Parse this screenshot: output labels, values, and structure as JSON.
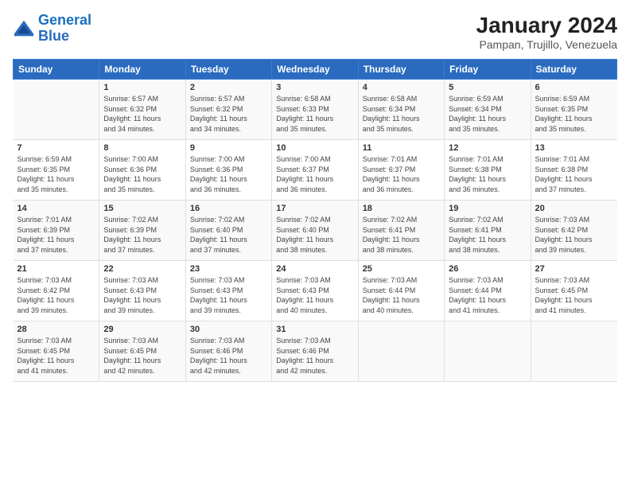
{
  "logo": {
    "line1": "General",
    "line2": "Blue"
  },
  "title": "January 2024",
  "location": "Pampan, Trujillo, Venezuela",
  "days_of_week": [
    "Sunday",
    "Monday",
    "Tuesday",
    "Wednesday",
    "Thursday",
    "Friday",
    "Saturday"
  ],
  "weeks": [
    [
      {
        "day": "",
        "info": ""
      },
      {
        "day": "1",
        "info": "Sunrise: 6:57 AM\nSunset: 6:32 PM\nDaylight: 11 hours\nand 34 minutes."
      },
      {
        "day": "2",
        "info": "Sunrise: 6:57 AM\nSunset: 6:32 PM\nDaylight: 11 hours\nand 34 minutes."
      },
      {
        "day": "3",
        "info": "Sunrise: 6:58 AM\nSunset: 6:33 PM\nDaylight: 11 hours\nand 35 minutes."
      },
      {
        "day": "4",
        "info": "Sunrise: 6:58 AM\nSunset: 6:34 PM\nDaylight: 11 hours\nand 35 minutes."
      },
      {
        "day": "5",
        "info": "Sunrise: 6:59 AM\nSunset: 6:34 PM\nDaylight: 11 hours\nand 35 minutes."
      },
      {
        "day": "6",
        "info": "Sunrise: 6:59 AM\nSunset: 6:35 PM\nDaylight: 11 hours\nand 35 minutes."
      }
    ],
    [
      {
        "day": "7",
        "info": "Sunrise: 6:59 AM\nSunset: 6:35 PM\nDaylight: 11 hours\nand 35 minutes."
      },
      {
        "day": "8",
        "info": "Sunrise: 7:00 AM\nSunset: 6:36 PM\nDaylight: 11 hours\nand 35 minutes."
      },
      {
        "day": "9",
        "info": "Sunrise: 7:00 AM\nSunset: 6:36 PM\nDaylight: 11 hours\nand 36 minutes."
      },
      {
        "day": "10",
        "info": "Sunrise: 7:00 AM\nSunset: 6:37 PM\nDaylight: 11 hours\nand 36 minutes."
      },
      {
        "day": "11",
        "info": "Sunrise: 7:01 AM\nSunset: 6:37 PM\nDaylight: 11 hours\nand 36 minutes."
      },
      {
        "day": "12",
        "info": "Sunrise: 7:01 AM\nSunset: 6:38 PM\nDaylight: 11 hours\nand 36 minutes."
      },
      {
        "day": "13",
        "info": "Sunrise: 7:01 AM\nSunset: 6:38 PM\nDaylight: 11 hours\nand 37 minutes."
      }
    ],
    [
      {
        "day": "14",
        "info": "Sunrise: 7:01 AM\nSunset: 6:39 PM\nDaylight: 11 hours\nand 37 minutes."
      },
      {
        "day": "15",
        "info": "Sunrise: 7:02 AM\nSunset: 6:39 PM\nDaylight: 11 hours\nand 37 minutes."
      },
      {
        "day": "16",
        "info": "Sunrise: 7:02 AM\nSunset: 6:40 PM\nDaylight: 11 hours\nand 37 minutes."
      },
      {
        "day": "17",
        "info": "Sunrise: 7:02 AM\nSunset: 6:40 PM\nDaylight: 11 hours\nand 38 minutes."
      },
      {
        "day": "18",
        "info": "Sunrise: 7:02 AM\nSunset: 6:41 PM\nDaylight: 11 hours\nand 38 minutes."
      },
      {
        "day": "19",
        "info": "Sunrise: 7:02 AM\nSunset: 6:41 PM\nDaylight: 11 hours\nand 38 minutes."
      },
      {
        "day": "20",
        "info": "Sunrise: 7:03 AM\nSunset: 6:42 PM\nDaylight: 11 hours\nand 39 minutes."
      }
    ],
    [
      {
        "day": "21",
        "info": "Sunrise: 7:03 AM\nSunset: 6:42 PM\nDaylight: 11 hours\nand 39 minutes."
      },
      {
        "day": "22",
        "info": "Sunrise: 7:03 AM\nSunset: 6:43 PM\nDaylight: 11 hours\nand 39 minutes."
      },
      {
        "day": "23",
        "info": "Sunrise: 7:03 AM\nSunset: 6:43 PM\nDaylight: 11 hours\nand 39 minutes."
      },
      {
        "day": "24",
        "info": "Sunrise: 7:03 AM\nSunset: 6:43 PM\nDaylight: 11 hours\nand 40 minutes."
      },
      {
        "day": "25",
        "info": "Sunrise: 7:03 AM\nSunset: 6:44 PM\nDaylight: 11 hours\nand 40 minutes."
      },
      {
        "day": "26",
        "info": "Sunrise: 7:03 AM\nSunset: 6:44 PM\nDaylight: 11 hours\nand 41 minutes."
      },
      {
        "day": "27",
        "info": "Sunrise: 7:03 AM\nSunset: 6:45 PM\nDaylight: 11 hours\nand 41 minutes."
      }
    ],
    [
      {
        "day": "28",
        "info": "Sunrise: 7:03 AM\nSunset: 6:45 PM\nDaylight: 11 hours\nand 41 minutes."
      },
      {
        "day": "29",
        "info": "Sunrise: 7:03 AM\nSunset: 6:45 PM\nDaylight: 11 hours\nand 42 minutes."
      },
      {
        "day": "30",
        "info": "Sunrise: 7:03 AM\nSunset: 6:46 PM\nDaylight: 11 hours\nand 42 minutes."
      },
      {
        "day": "31",
        "info": "Sunrise: 7:03 AM\nSunset: 6:46 PM\nDaylight: 11 hours\nand 42 minutes."
      },
      {
        "day": "",
        "info": ""
      },
      {
        "day": "",
        "info": ""
      },
      {
        "day": "",
        "info": ""
      }
    ]
  ]
}
